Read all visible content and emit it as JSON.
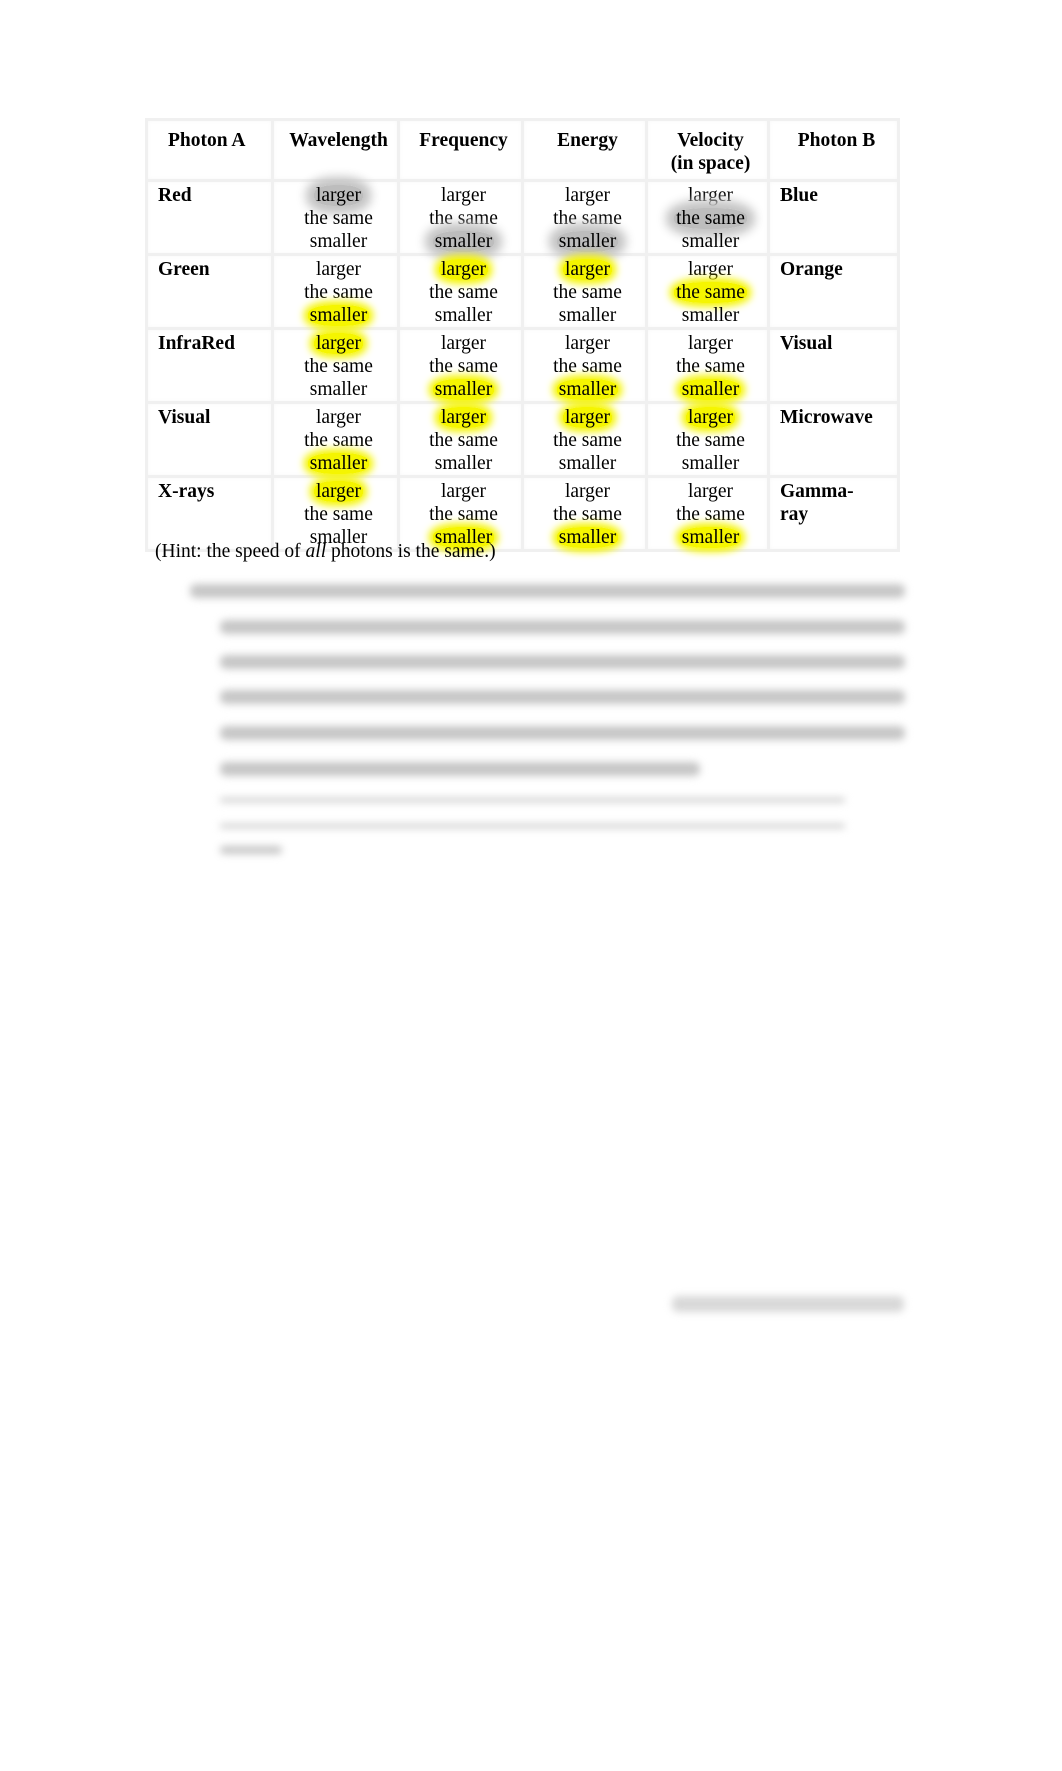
{
  "table": {
    "headers": {
      "photon_a": "Photon A",
      "wavelength": "Wavelength",
      "frequency": "Frequency",
      "energy": "Energy",
      "velocity_line1": "Velocity",
      "velocity_line2": "(in space)",
      "photon_b": "Photon B"
    },
    "options": [
      "larger",
      "the same",
      "smaller"
    ],
    "rows": [
      {
        "photon_a": "Red",
        "photon_b": "Blue",
        "wavelength": {
          "highlighted": "larger",
          "highlight_style": "gray"
        },
        "frequency": {
          "highlighted": "smaller",
          "highlight_style": "gray"
        },
        "energy": {
          "highlighted": "smaller",
          "highlight_style": "gray"
        },
        "velocity": {
          "highlighted": "the same",
          "highlight_style": "gray"
        }
      },
      {
        "photon_a": "Green",
        "photon_b": "Orange",
        "wavelength": {
          "highlighted": "smaller",
          "highlight_style": "yellow"
        },
        "frequency": {
          "highlighted": "larger",
          "highlight_style": "yellow"
        },
        "energy": {
          "highlighted": "larger",
          "highlight_style": "yellow"
        },
        "velocity": {
          "highlighted": "the same",
          "highlight_style": "yellow"
        }
      },
      {
        "photon_a": "InfraRed",
        "photon_b": "Visual",
        "wavelength": {
          "highlighted": "larger",
          "highlight_style": "yellow"
        },
        "frequency": {
          "highlighted": "smaller",
          "highlight_style": "yellow"
        },
        "energy": {
          "highlighted": "smaller",
          "highlight_style": "yellow"
        },
        "velocity": {
          "highlighted": "smaller",
          "highlight_style": "yellow"
        }
      },
      {
        "photon_a": "Visual",
        "photon_b": "Microwave",
        "wavelength": {
          "highlighted": "smaller",
          "highlight_style": "yellow"
        },
        "frequency": {
          "highlighted": "larger",
          "highlight_style": "yellow"
        },
        "energy": {
          "highlighted": "larger",
          "highlight_style": "yellow"
        },
        "velocity": {
          "highlighted": "larger",
          "highlight_style": "yellow"
        }
      },
      {
        "photon_a": "X-rays",
        "photon_b": "Gamma-ray",
        "photon_b_lines": [
          "Gamma-",
          "ray"
        ],
        "wavelength": {
          "highlighted": "larger",
          "highlight_style": "yellow"
        },
        "frequency": {
          "highlighted": "smaller",
          "highlight_style": "yellow"
        },
        "energy": {
          "highlighted": "smaller",
          "highlight_style": "yellow"
        },
        "velocity": {
          "highlighted": "smaller",
          "highlight_style": "yellow"
        }
      }
    ]
  },
  "hint": {
    "before": "(Hint: the speed of ",
    "italic": "all",
    "after": " photons is the same.)"
  },
  "colors": {
    "highlight_yellow": "#f5f500",
    "highlight_gray": "#bdbdbd"
  }
}
